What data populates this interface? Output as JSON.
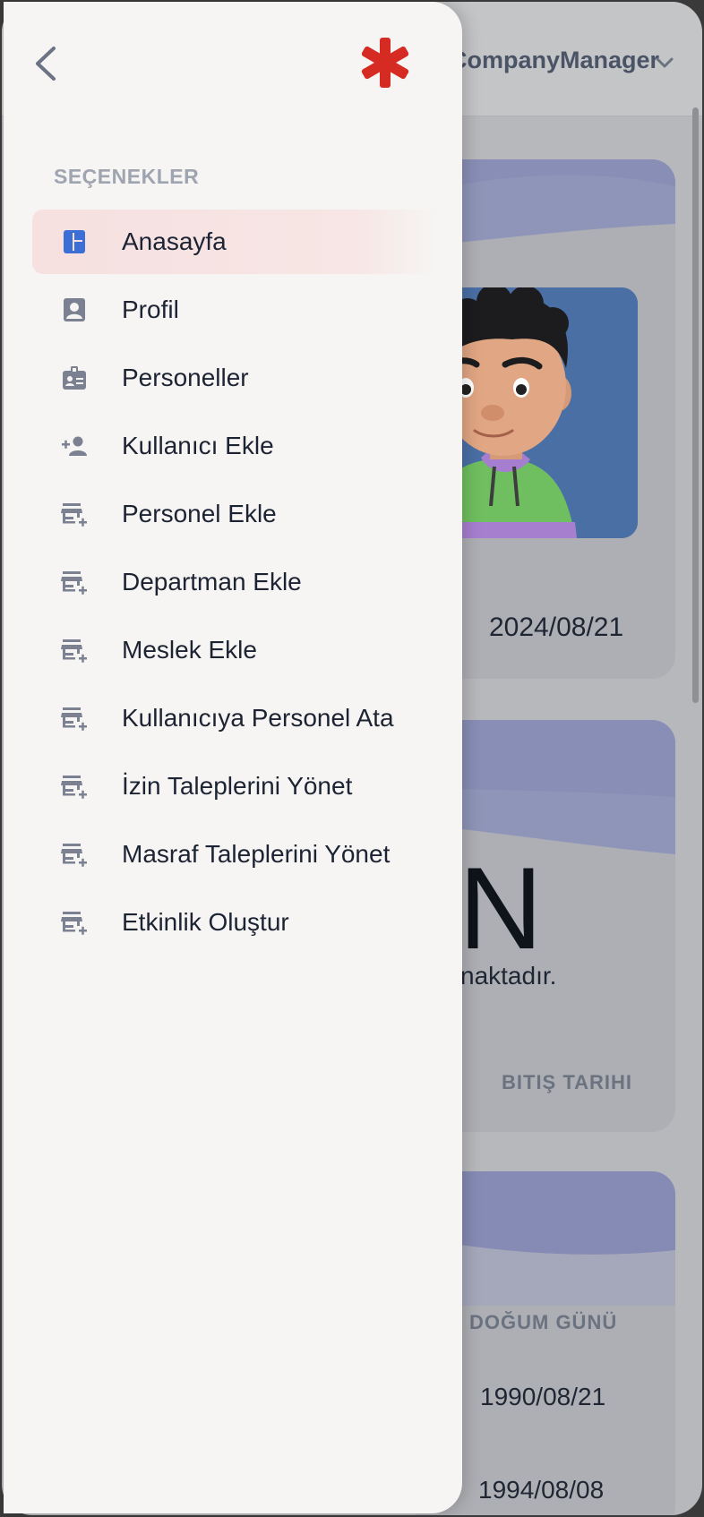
{
  "background": {
    "header_user": "CompanyManager",
    "card1": {
      "date": "2024/08/21"
    },
    "card2": {
      "big_text": "N",
      "subtitle": "naktadır.",
      "column_header": "BITIŞ TARIHI"
    },
    "card3": {
      "column_header": "DOĞUM GÜNÜ",
      "dates": [
        "1990/08/21",
        "1994/08/08"
      ]
    }
  },
  "drawer": {
    "section_label": "SEÇENEKLER",
    "items": [
      {
        "label": "Anasayfa",
        "icon": "dashboard-icon",
        "active": true
      },
      {
        "label": "Profil",
        "icon": "profile-icon"
      },
      {
        "label": "Personeller",
        "icon": "badge-icon"
      },
      {
        "label": "Kullanıcı Ekle",
        "icon": "person-add-icon"
      },
      {
        "label": "Personel Ekle",
        "icon": "store-add-icon"
      },
      {
        "label": "Departman Ekle",
        "icon": "store-add-icon"
      },
      {
        "label": "Meslek Ekle",
        "icon": "store-add-icon"
      },
      {
        "label": "Kullanıcıya Personel Ata",
        "icon": "store-add-icon"
      },
      {
        "label": "İzin Taleplerini Yönet",
        "icon": "store-add-icon"
      },
      {
        "label": "Masraf Taleplerini Yönet",
        "icon": "store-add-icon"
      },
      {
        "label": "Etkinlik Oluştur",
        "icon": "store-add-icon"
      }
    ]
  },
  "colors": {
    "accent_blue": "#3b6fd6",
    "logo_red": "#d62b23",
    "active_bg": "#f6e0e0",
    "icon_gray": "#7b8190"
  }
}
